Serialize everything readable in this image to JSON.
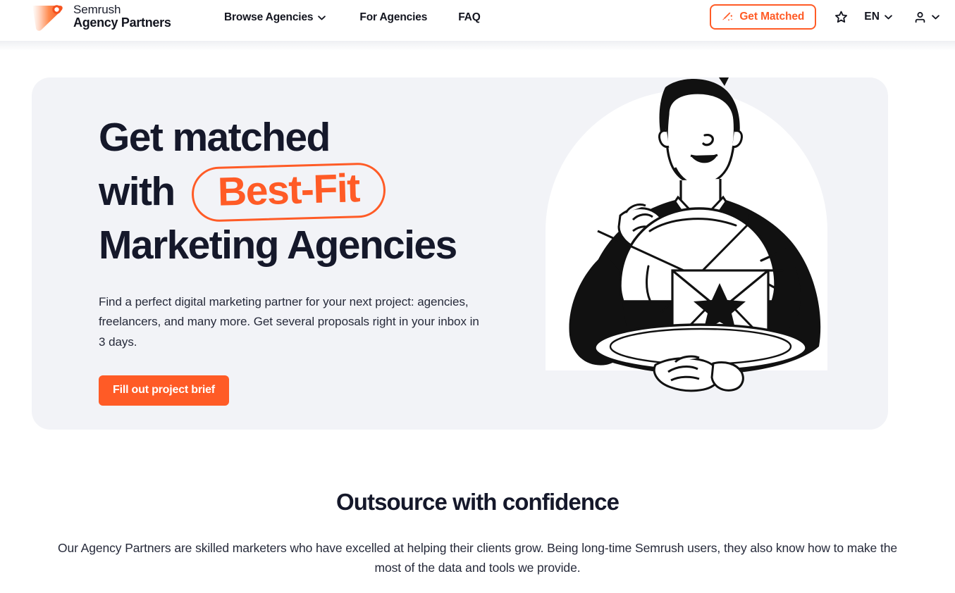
{
  "header": {
    "logo": {
      "icon": "semrush-flag-logo",
      "line1": "Semrush",
      "line2": "Agency Partners"
    },
    "nav": [
      {
        "label": "Browse Agencies",
        "has_dropdown": true,
        "icon": "chevron-down-icon"
      },
      {
        "label": "For Agencies",
        "has_dropdown": false
      },
      {
        "label": "FAQ",
        "has_dropdown": false
      }
    ],
    "get_matched": {
      "label": "Get Matched",
      "icon": "magic-wand-icon",
      "color": "#ff5b26"
    },
    "favorites_icon": "star-outline-icon",
    "language": {
      "label": "EN",
      "icon": "chevron-down-icon"
    },
    "account": {
      "icon": "user-icon",
      "chevron": "chevron-down-icon"
    }
  },
  "hero": {
    "background": "#f2f3f7",
    "title": {
      "line1": "Get matched",
      "line2_prefix": "with",
      "line2_highlight": "Best-Fit",
      "line3": "Marketing Agencies"
    },
    "description": "Find a perfect digital marketing partner for your next project: agencies, freelancers, and many more. Get several proposals right in your inbox in 3 days.",
    "cta": {
      "label": "Fill out project brief",
      "color": "#ff5b26"
    },
    "illustration": "waiter-serving-envelope-on-tray-illustration"
  },
  "section": {
    "title": "Outsource with confidence",
    "description": "Our Agency Partners are skilled marketers who have excelled at helping their clients grow. Being long-time Semrush users, they also know how to make the most of the data and tools we provide."
  },
  "colors": {
    "accent": "#ff5b26",
    "text_dark": "#15182a",
    "card_bg": "#f2f3f7",
    "page_bg": "#ffffff"
  }
}
